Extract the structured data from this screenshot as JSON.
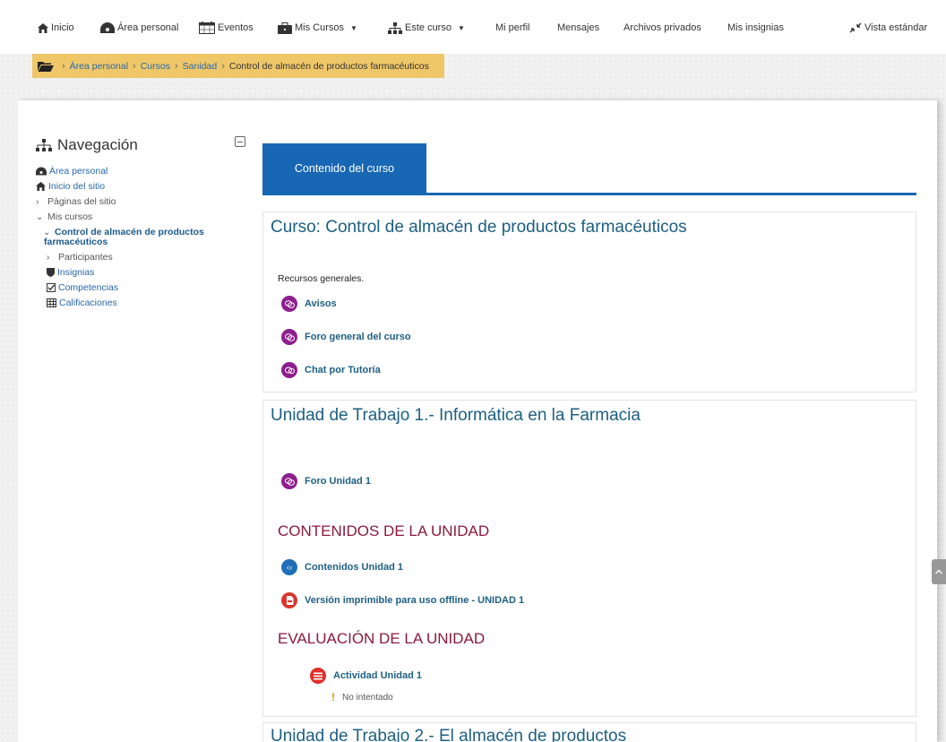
{
  "topnav": {
    "items": [
      {
        "label": "Inicio"
      },
      {
        "label": "Área personal"
      },
      {
        "label": "Eventos"
      },
      {
        "label": "Mis Cursos"
      },
      {
        "label": "Este curso"
      },
      {
        "label": "Mi perfil"
      },
      {
        "label": "Mensajes"
      },
      {
        "label": "Archivos privados"
      },
      {
        "label": "Mis insignias"
      },
      {
        "label": "Vista estándar"
      }
    ]
  },
  "breadcrumb": {
    "items": [
      "Área personal",
      "Cursos",
      "Sanidad"
    ],
    "current": "Control de almacén de productos farmacéuticos"
  },
  "sidebar": {
    "title": "Navegación",
    "items": [
      {
        "label": "Área personal"
      },
      {
        "label": "Inicio del sitio"
      },
      {
        "label": "Páginas del sitio"
      },
      {
        "label": "Mis cursos"
      },
      {
        "label": "Control de almacén de productos farmacéuticos"
      },
      {
        "label": "Participantes"
      },
      {
        "label": "Insignias"
      },
      {
        "label": "Competencias"
      },
      {
        "label": "Calificaciones"
      }
    ]
  },
  "tab": {
    "label": "Contenido del curso"
  },
  "section0": {
    "title": "Curso: Control de almacén de productos farmacéuticos",
    "label": "Recursos generales.",
    "activities": [
      {
        "label": "Avisos",
        "color": "#8e1d8f"
      },
      {
        "label": "Foro general del curso",
        "color": "#8e1d8f"
      },
      {
        "label": "Chat por Tutoría",
        "color": "#8e1d8f"
      }
    ]
  },
  "section1": {
    "title": "Unidad de Trabajo 1.- Informática en la Farmacia",
    "forum": {
      "label": "Foro Unidad 1",
      "color": "#8e1d8f"
    },
    "contents_heading": "CONTENIDOS DE LA UNIDAD",
    "contents": [
      {
        "label": "Contenidos Unidad 1",
        "color": "#1f6fb8"
      },
      {
        "label": "Versión imprimible para uso offline - UNIDAD 1",
        "color": "#d9352e"
      }
    ],
    "evaluation_heading": "EVALUACIÓN DE LA UNIDAD",
    "evaluation": {
      "label": "Actividad Unidad 1",
      "color": "#e0302c",
      "status": "No intentado"
    }
  },
  "section2": {
    "title": "Unidad de Trabajo 2.- El almacén de productos"
  }
}
